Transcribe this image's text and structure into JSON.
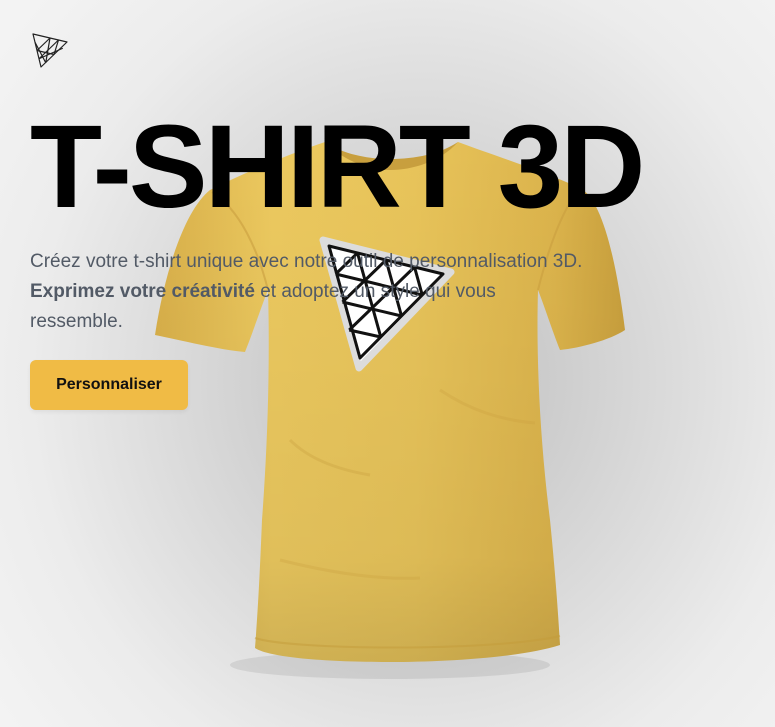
{
  "logo": {
    "icon": "triangle-grid-logo-icon"
  },
  "hero": {
    "title": "T-SHIRT 3D",
    "subtitle_part1": "Créez votre t-shirt unique avec notre outil de personnalisation 3D. ",
    "subtitle_strong": "Exprimez votre créativité",
    "subtitle_part2": " et adoptez un style qui vous ressemble.",
    "cta_label": "Personnaliser"
  },
  "shirt": {
    "color": "#e7c25a",
    "decal": "triangle-grid-decal"
  },
  "colors": {
    "accent": "#f0bb45",
    "title": "#000000",
    "text": "#525a66"
  }
}
